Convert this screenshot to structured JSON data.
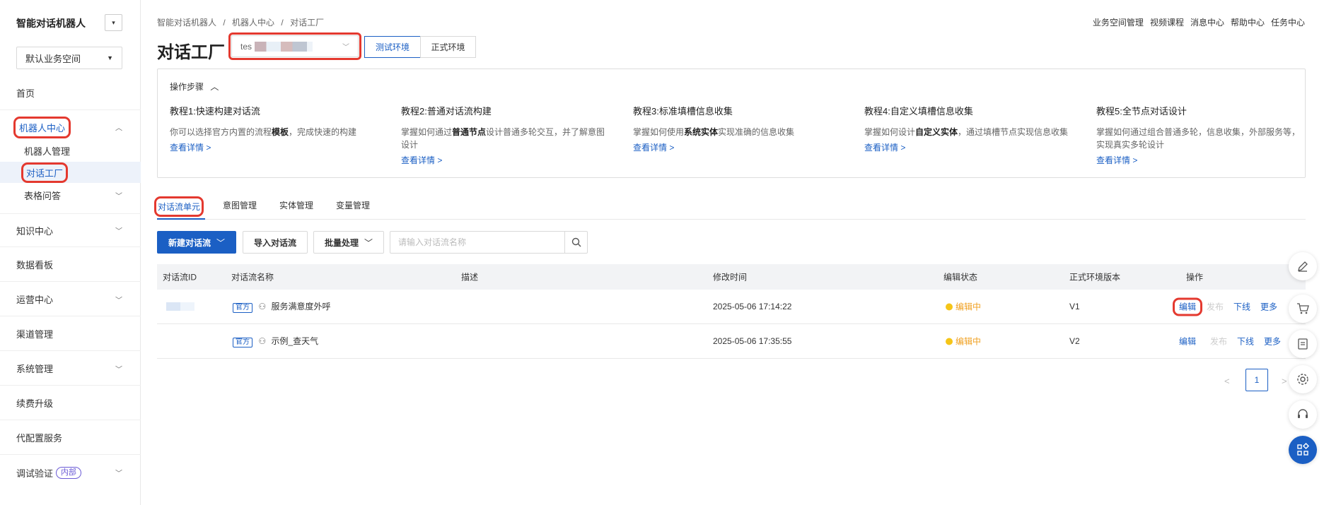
{
  "sidebar": {
    "title": "智能对话机器人",
    "collapse_icon": "▾",
    "space_select": "默认业务空间",
    "items": [
      {
        "label": "首页"
      },
      {
        "label": "机器人中心"
      },
      {
        "label": "知识中心"
      },
      {
        "label": "数据看板"
      },
      {
        "label": "运营中心"
      },
      {
        "label": "渠道管理"
      },
      {
        "label": "系统管理"
      },
      {
        "label": "续费升级"
      },
      {
        "label": "代配置服务"
      },
      {
        "label": "调试验证",
        "tag": "内部"
      }
    ],
    "sub_items": [
      {
        "label": "机器人管理"
      },
      {
        "label": "对话工厂"
      },
      {
        "label": "表格问答"
      }
    ]
  },
  "breadcrumb": [
    "智能对话机器人",
    "/",
    "机器人中心",
    "/",
    "对话工厂"
  ],
  "topnav": [
    "业务空间管理",
    "视频课程",
    "消息中心",
    "帮助中心",
    "任务中心"
  ],
  "page": {
    "title": "对话工厂",
    "bot_select_value": "tes",
    "env_test": "测试环境",
    "env_prod": "正式环境"
  },
  "steps": {
    "header": "操作步骤",
    "items": [
      {
        "title": "教程1:快速构建对话流",
        "pre": "你可以选择官方内置的流程",
        "bold": "模板",
        "post": "，完成快速的构建",
        "link": "查看详情 >"
      },
      {
        "title": "教程2:普通对话流构建",
        "pre": "掌握如何通过",
        "bold": "普通节点",
        "post": "设计普通多轮交互，并了解意图设计",
        "link": "查看详情 >"
      },
      {
        "title": "教程3:标准填槽信息收集",
        "pre": "掌握如何使用",
        "bold": "系统实体",
        "post": "实现准确的信息收集",
        "link": "查看详情 >"
      },
      {
        "title": "教程4:自定义填槽信息收集",
        "pre": "掌握如何设计",
        "bold": "自定义实体",
        "post": "，通过填槽节点实现信息收集",
        "link": "查看详情 >"
      },
      {
        "title": "教程5:全节点对话设计",
        "pre": "掌握如何通过组合普通多轮，信息收集，外部服务等，实现真实多轮设计",
        "bold": "",
        "post": "",
        "link": "查看详情 >"
      }
    ]
  },
  "tabs": [
    "对话流单元",
    "意图管理",
    "实体管理",
    "变量管理"
  ],
  "toolbar": {
    "new_flow": "新建对话流",
    "import_flow": "导入对话流",
    "batch": "批量处理",
    "search_placeholder": "请输入对话流名称"
  },
  "table": {
    "headers": [
      "对话流ID",
      "对话流名称",
      "描述",
      "修改时间",
      "编辑状态",
      "正式环境版本",
      "操作"
    ],
    "rows": [
      {
        "badge": "官方",
        "name": "服务满意度外呼",
        "desc": "",
        "time": "2025-05-06 17:14:22",
        "status": "编辑中",
        "version": "V1"
      },
      {
        "badge": "官方",
        "name": "示例_查天气",
        "desc": "",
        "time": "2025-05-06 17:35:55",
        "status": "编辑中",
        "version": "V2"
      }
    ],
    "ops": [
      "编辑",
      "发布",
      "下线",
      "更多"
    ]
  },
  "pagination": {
    "prev": "<",
    "current": "1",
    "next": ">"
  },
  "colors": {
    "primary": "#1b5fc4",
    "status_editing": "#f0a020",
    "highlight": "#e4392f"
  }
}
